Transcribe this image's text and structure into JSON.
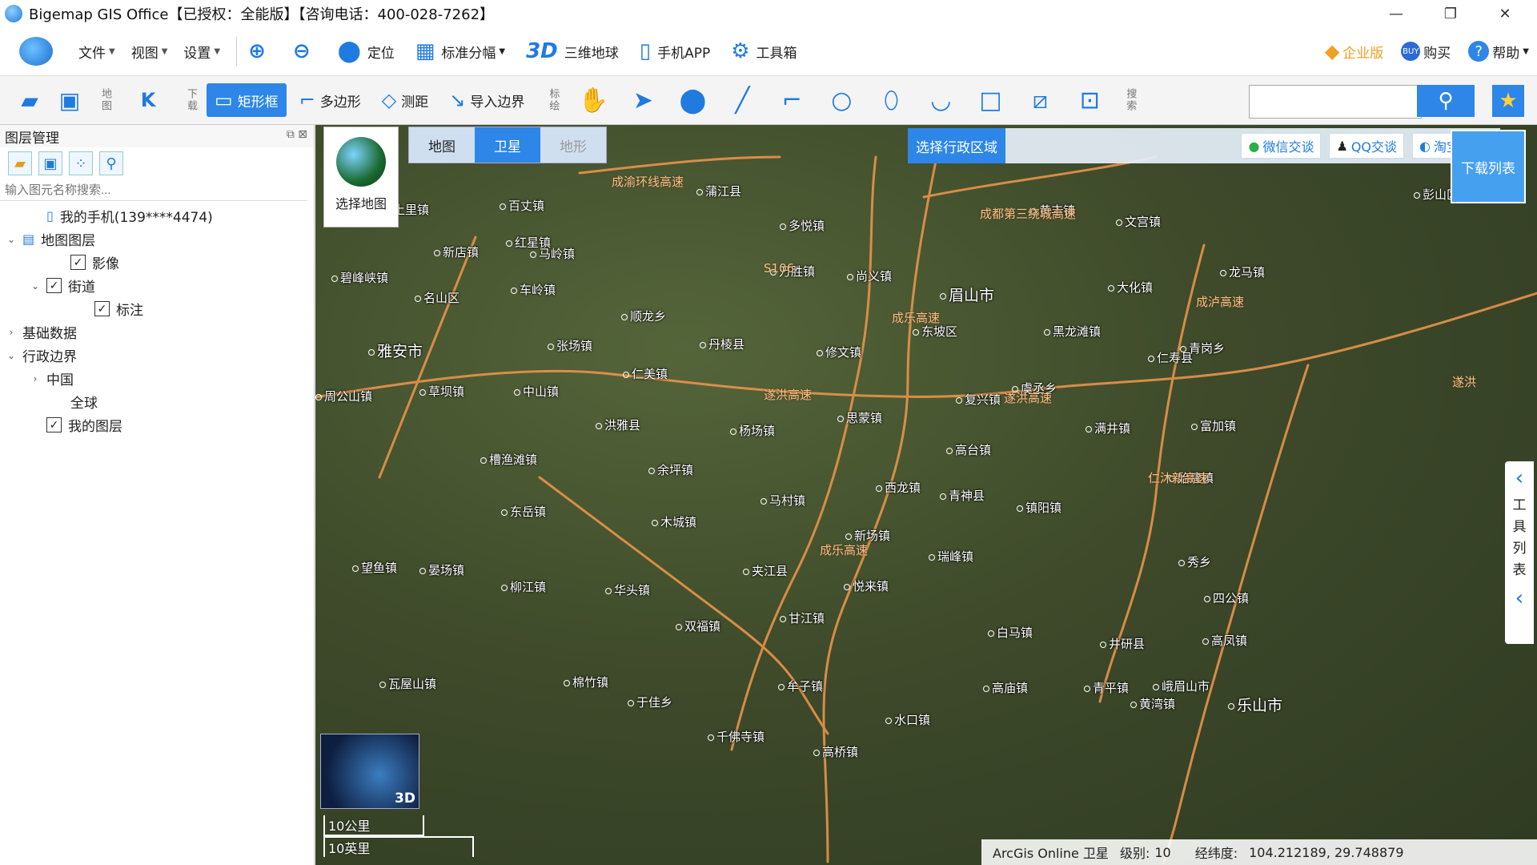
{
  "window": {
    "title": "Bigemap GIS Office【已授权：全能版】【咨询电话：400-028-7262】",
    "controls": [
      "—",
      "❐",
      "✕"
    ]
  },
  "menubar": {
    "menus": [
      "文件",
      "视图",
      "设置"
    ],
    "tools": [
      {
        "label": "定位",
        "icon": "location-pin-icon"
      },
      {
        "label": "标准分幅",
        "icon": "grid-icon"
      },
      {
        "label": "三维地球",
        "icon": "3d-icon",
        "prefix": "3D"
      },
      {
        "label": "手机APP",
        "icon": "phone-icon"
      },
      {
        "label": "工具箱",
        "icon": "gear-icon"
      }
    ],
    "right": [
      {
        "label": "企业版",
        "icon": "diamond-icon"
      },
      {
        "label": "购买",
        "icon": "buy-icon"
      },
      {
        "label": "帮助",
        "icon": "help-icon"
      }
    ]
  },
  "toolbar2": {
    "labels": {
      "map": "地图",
      "download": "下载",
      "draw": "标绘",
      "search": "搜索"
    },
    "buttons": [
      {
        "label": "矩形框",
        "active": true
      },
      {
        "label": "多边形",
        "active": false
      },
      {
        "label": "测距",
        "active": false
      },
      {
        "label": "导入边界",
        "active": false
      }
    ],
    "search_value": ""
  },
  "leftpanel": {
    "title": "图层管理",
    "search_placeholder": "输入图元名称搜索...",
    "tree": [
      {
        "label": "我的手机(139****4474)",
        "level": 1,
        "arrow": "",
        "checkbox": null,
        "icon": "phone-icon"
      },
      {
        "label": "地图图层",
        "level": 0,
        "arrow": "⌄",
        "checkbox": null,
        "icon": "layers-icon"
      },
      {
        "label": "影像",
        "level": 2,
        "arrow": "",
        "checkbox": true
      },
      {
        "label": "街道",
        "level": 1,
        "arrow": "⌄",
        "checkbox": true
      },
      {
        "label": "标注",
        "level": 3,
        "arrow": "",
        "checkbox": true
      },
      {
        "label": "基础数据",
        "level": 0,
        "arrow": "›",
        "checkbox": null
      },
      {
        "label": "行政边界",
        "level": 0,
        "arrow": "⌄",
        "checkbox": null
      },
      {
        "label": "中国",
        "level": 1,
        "arrow": "›",
        "checkbox": null
      },
      {
        "label": "全球",
        "level": 2,
        "arrow": "",
        "checkbox": null
      },
      {
        "label": "我的图层",
        "level": 1,
        "arrow": "",
        "checkbox": true
      }
    ]
  },
  "map": {
    "select_label": "选择地图",
    "tabs": [
      {
        "label": "地图",
        "state": "normal"
      },
      {
        "label": "卫星",
        "state": "active"
      },
      {
        "label": "地形",
        "state": "dim"
      }
    ],
    "region_button": "选择行政区域",
    "chat_buttons": [
      "微信交谈",
      "QQ交谈",
      "淘宝购买"
    ],
    "download_list": "下载列表",
    "tool_list": [
      "工",
      "具",
      "列",
      "表"
    ],
    "mini_globe_label": "3D",
    "scale": {
      "km": "10公里",
      "mi": "10英里"
    },
    "status": {
      "source": "ArcGis Online 卫星",
      "level_label": "级别:",
      "level": "10",
      "coord_label": "经纬度:",
      "coords": "104.212189, 29.748879"
    },
    "places": [
      {
        "name": "蒲江县",
        "type": "town"
      },
      {
        "name": "彭山区",
        "type": "town"
      },
      {
        "name": "黄丰镇",
        "type": "small"
      },
      {
        "name": "文宫镇",
        "type": "small"
      },
      {
        "name": "上里镇",
        "type": "small"
      },
      {
        "name": "百丈镇",
        "type": "small"
      },
      {
        "name": "多悦镇",
        "type": "small"
      },
      {
        "name": "新店镇",
        "type": "small"
      },
      {
        "name": "红星镇",
        "type": "small"
      },
      {
        "name": "马岭镇",
        "type": "small"
      },
      {
        "name": "碧峰峡镇",
        "type": "small"
      },
      {
        "name": "万胜镇",
        "type": "small"
      },
      {
        "name": "尚义镇",
        "type": "small"
      },
      {
        "name": "龙马镇",
        "type": "small"
      },
      {
        "name": "名山区",
        "type": "town"
      },
      {
        "name": "车岭镇",
        "type": "small"
      },
      {
        "name": "眉山市",
        "type": "city"
      },
      {
        "name": "大化镇",
        "type": "small"
      },
      {
        "name": "顺龙乡",
        "type": "small"
      },
      {
        "name": "东坡区",
        "type": "town"
      },
      {
        "name": "黑龙滩镇",
        "type": "small"
      },
      {
        "name": "雅安市",
        "type": "city"
      },
      {
        "name": "张场镇",
        "type": "small"
      },
      {
        "name": "丹棱县",
        "type": "town"
      },
      {
        "name": "修文镇",
        "type": "small"
      },
      {
        "name": "仁寿县",
        "type": "town"
      },
      {
        "name": "青岗乡",
        "type": "small"
      },
      {
        "name": "仁美镇",
        "type": "small"
      },
      {
        "name": "虞丞乡",
        "type": "small"
      },
      {
        "name": "周公山镇",
        "type": "small"
      },
      {
        "name": "草坝镇",
        "type": "small"
      },
      {
        "name": "中山镇",
        "type": "small"
      },
      {
        "name": "复兴镇",
        "type": "small"
      },
      {
        "name": "思蒙镇",
        "type": "small"
      },
      {
        "name": "洪雅县",
        "type": "town"
      },
      {
        "name": "杨场镇",
        "type": "small"
      },
      {
        "name": "满井镇",
        "type": "small"
      },
      {
        "name": "富加镇",
        "type": "small"
      },
      {
        "name": "高台镇",
        "type": "small"
      },
      {
        "name": "槽渔滩镇",
        "type": "small"
      },
      {
        "name": "余坪镇",
        "type": "small"
      },
      {
        "name": "始建镇",
        "type": "small"
      },
      {
        "name": "西龙镇",
        "type": "small"
      },
      {
        "name": "青神县",
        "type": "town"
      },
      {
        "name": "马村镇",
        "type": "small"
      },
      {
        "name": "镇阳镇",
        "type": "small"
      },
      {
        "name": "东岳镇",
        "type": "small"
      },
      {
        "name": "木城镇",
        "type": "small"
      },
      {
        "name": "新场镇",
        "type": "small"
      },
      {
        "name": "瑞峰镇",
        "type": "small"
      },
      {
        "name": "秀乡",
        "type": "small"
      },
      {
        "name": "望鱼镇",
        "type": "small"
      },
      {
        "name": "晏场镇",
        "type": "small"
      },
      {
        "name": "夹江县",
        "type": "town"
      },
      {
        "name": "柳江镇",
        "type": "small"
      },
      {
        "name": "华头镇",
        "type": "small"
      },
      {
        "name": "悦来镇",
        "type": "small"
      },
      {
        "name": "四公镇",
        "type": "small"
      },
      {
        "name": "甘江镇",
        "type": "small"
      },
      {
        "name": "双福镇",
        "type": "small"
      },
      {
        "name": "白马镇",
        "type": "small"
      },
      {
        "name": "井研县",
        "type": "town"
      },
      {
        "name": "高凤镇",
        "type": "small"
      },
      {
        "name": "瓦屋山镇",
        "type": "small"
      },
      {
        "name": "棉竹镇",
        "type": "small"
      },
      {
        "name": "牟子镇",
        "type": "small"
      },
      {
        "name": "高庙镇",
        "type": "small"
      },
      {
        "name": "峨眉山市",
        "type": "town"
      },
      {
        "name": "青平镇",
        "type": "small"
      },
      {
        "name": "于佳乡",
        "type": "small"
      },
      {
        "name": "黄湾镇",
        "type": "small"
      },
      {
        "name": "千佛寺镇",
        "type": "small"
      },
      {
        "name": "乐山市",
        "type": "city"
      },
      {
        "name": "水口镇",
        "type": "small"
      },
      {
        "name": "高桥镇",
        "type": "small"
      }
    ],
    "roads": [
      "成渝环线高速",
      "成都第三绕城高速",
      "S106",
      "遂洪高速",
      "遂洪高速",
      "成乐高速",
      "成乐高速",
      "仁沐新高速",
      "成泸高速",
      "遂洪"
    ]
  }
}
